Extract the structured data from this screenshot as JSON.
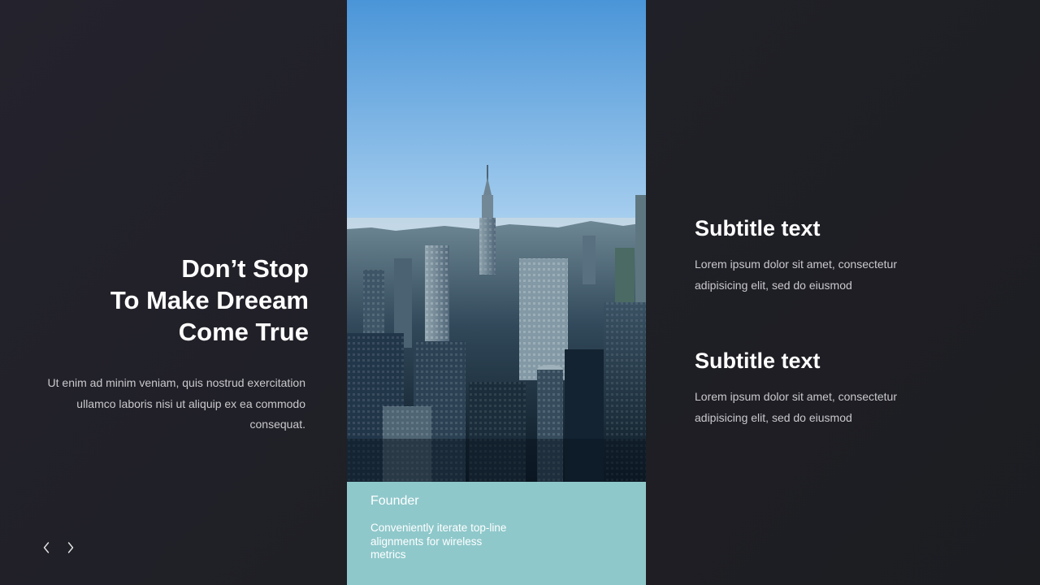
{
  "hero": {
    "headline_lines": [
      "Don’t Stop",
      "To Make Dreeam",
      "Come True"
    ],
    "body": "Ut enim ad minim veniam, quis nostrud exercitation ullamco laboris nisi ut aliquip ex ea commodo consequat."
  },
  "navigation": {
    "prev_icon": "chevron-left-icon",
    "next_icon": "chevron-right-icon"
  },
  "photo": {
    "subject": "city skyline photo"
  },
  "caption_card": {
    "title": "Founder",
    "text": "Conveniently iterate top-line alignments for wireless metrics"
  },
  "features": [
    {
      "title": "Subtitle text",
      "text": "Lorem ipsum dolor sit amet, consectetur adipisicing elit, sed do eiusmod"
    },
    {
      "title": "Subtitle text",
      "text": "Lorem ipsum dolor sit amet, consectetur adipisicing elit, sed do eiusmod"
    }
  ],
  "colors": {
    "background": "#1f1f26",
    "accent_card": "#8fc8cb",
    "text_primary": "#ffffff",
    "text_secondary": "#c9c9cd"
  }
}
